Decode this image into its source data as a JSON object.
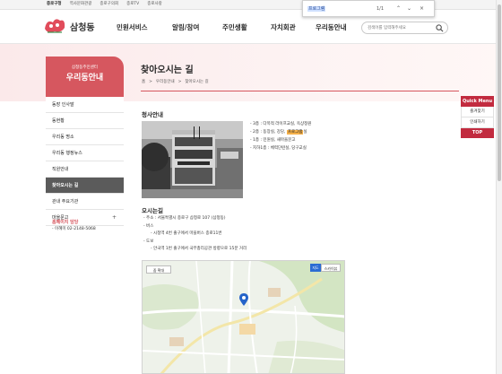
{
  "topbar": {
    "links": [
      "종로구청",
      "역사문화관광",
      "종로구의회",
      "종로TV",
      "종로사랑"
    ]
  },
  "find": {
    "query": "프로그램",
    "count": "1/1"
  },
  "header": {
    "site_name": "삼청동",
    "nav": [
      "민원서비스",
      "알림/참여",
      "주민생활",
      "자치회관",
      "우리동안내"
    ],
    "search_placeholder": "검색어를 입력해주세요"
  },
  "sidebar": {
    "subtitle": "삼청동주민센터",
    "title": "우리동안내",
    "items": [
      {
        "label": "동장 인사말"
      },
      {
        "label": "동현황"
      },
      {
        "label": "우리동 명소"
      },
      {
        "label": "우리동 행정뉴스"
      },
      {
        "label": "직원안내"
      },
      {
        "label": "찾아오시는 길"
      },
      {
        "label": "관내 주요기관"
      },
      {
        "label": "마을문고"
      }
    ],
    "contact_title": "홈페이지 담당",
    "contact_value": "- 이혜미 02-2148-5068"
  },
  "main": {
    "title": "찾아오시는 길",
    "breadcrumb": [
      "홈",
      ">",
      "우리동안내",
      ">",
      "찾아오시는 길"
    ],
    "sec1_title": "청사안내",
    "floors": [
      {
        "pre": "- 3층 : 다목적 라이프교실, 옥상정원",
        "hl": "",
        "post": ""
      },
      {
        "pre": "- 2층 : 동장실, 강당, ",
        "hl": "프로그램",
        "post": "실"
      },
      {
        "pre": "- 1층 : 민원실, 새마을문고",
        "hl": "",
        "post": ""
      },
      {
        "pre": "- 지하1층 : 체력단련실, 당구교실",
        "hl": "",
        "post": ""
      }
    ],
    "sec2_title": "오시는길",
    "address": "- 주소 : 서울특별시 종로구 삼청로 107 (삼청동)",
    "bus_label": "- 버스",
    "bus_detail": "- 시청역 4번 출구에서 마을버스 종로11번",
    "walk_label": "- 도보",
    "walk_detail": "- 안국역 1번 출구에서 국무총리공관 방향으로 15분 거리",
    "map_btn_zoom": "줌 확대",
    "map_btn_map": "지도",
    "map_btn_sky": "스카이뷰"
  },
  "quick": {
    "title": "Quick Menu",
    "items": [
      "즐겨찾기",
      "인쇄하기"
    ],
    "top": "TOP"
  },
  "colors": {
    "accent": "#d6575f",
    "quick": "#c22b3f",
    "highlight": "#f5b14a"
  }
}
